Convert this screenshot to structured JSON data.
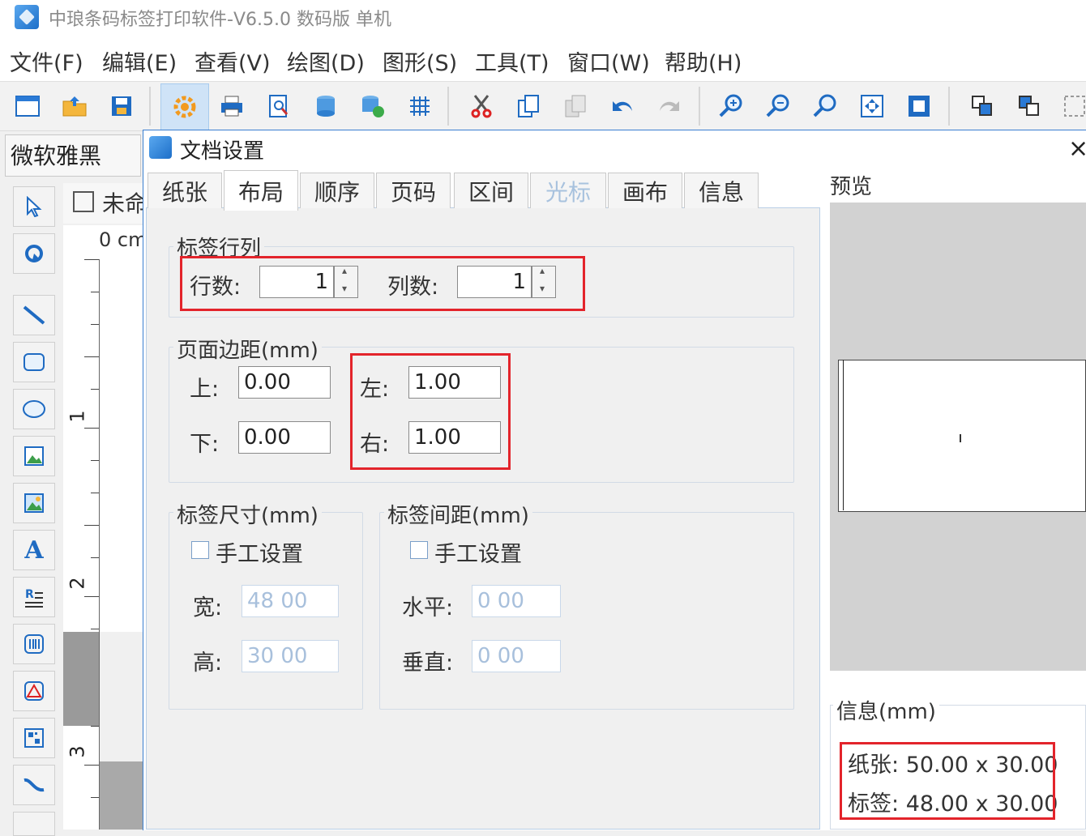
{
  "app": {
    "title": "中琅条码标签打印软件-V6.5.0 数码版 单机"
  },
  "menu": [
    "文件(F)",
    "编辑(E)",
    "查看(V)",
    "绘图(D)",
    "图形(S)",
    "工具(T)",
    "窗口(W)",
    "帮助(H)"
  ],
  "toolbar": {
    "icons": [
      "new-icon",
      "open-icon",
      "save-icon",
      "settings-icon",
      "print-icon",
      "print-preview-icon",
      "database-icon",
      "database-link-icon",
      "grid-icon",
      "cut-icon",
      "copy-icon",
      "paste-icon",
      "undo-icon",
      "redo-icon",
      "zoom-in-icon",
      "zoom-out-icon",
      "zoom-actual-icon",
      "fit-window-icon",
      "fit-page-icon",
      "bring-front-icon",
      "send-back-icon",
      "group-icon"
    ]
  },
  "font_box": {
    "value": "微软雅黑"
  },
  "doc_tab": {
    "label": "未命"
  },
  "ruler": {
    "top_label": "0 cm",
    "marks": [
      "1",
      "2",
      "3"
    ]
  },
  "dialog": {
    "title": "文档设置",
    "close": "×",
    "tabs": [
      "纸张",
      "布局",
      "顺序",
      "页码",
      "区间",
      "光标",
      "画布",
      "信息"
    ],
    "active_tab": "布局",
    "rows_cols": {
      "title": "标签行列",
      "rows_label": "行数:",
      "rows_value": "1",
      "cols_label": "列数:",
      "cols_value": "1"
    },
    "margins": {
      "title": "页面边距(mm)",
      "top_label": "上:",
      "top_value": "0.00",
      "bottom_label": "下:",
      "bottom_value": "0.00",
      "left_label": "左:",
      "left_value": "1.00",
      "right_label": "右:",
      "right_value": "1.00"
    },
    "label_size": {
      "title": "标签尺寸(mm)",
      "manual_label": "手工设置",
      "width_label": "宽:",
      "width_value": "48 00",
      "height_label": "高:",
      "height_value": "30 00"
    },
    "label_gap": {
      "title": "标签间距(mm)",
      "manual_label": "手工设置",
      "horizontal_label": "水平:",
      "horizontal_value": "0 00",
      "vertical_label": "垂直:",
      "vertical_value": "0 00"
    },
    "preview": {
      "title": "预览"
    },
    "info": {
      "title": "信息(mm)",
      "paper_label": "纸张:",
      "paper_value": "50.00 x 30.00",
      "label_label": "标签:",
      "label_value": "48.00 x 30.00"
    }
  },
  "colors": {
    "highlight_red": "#e3242b",
    "accent_blue": "#1f6bc2"
  }
}
